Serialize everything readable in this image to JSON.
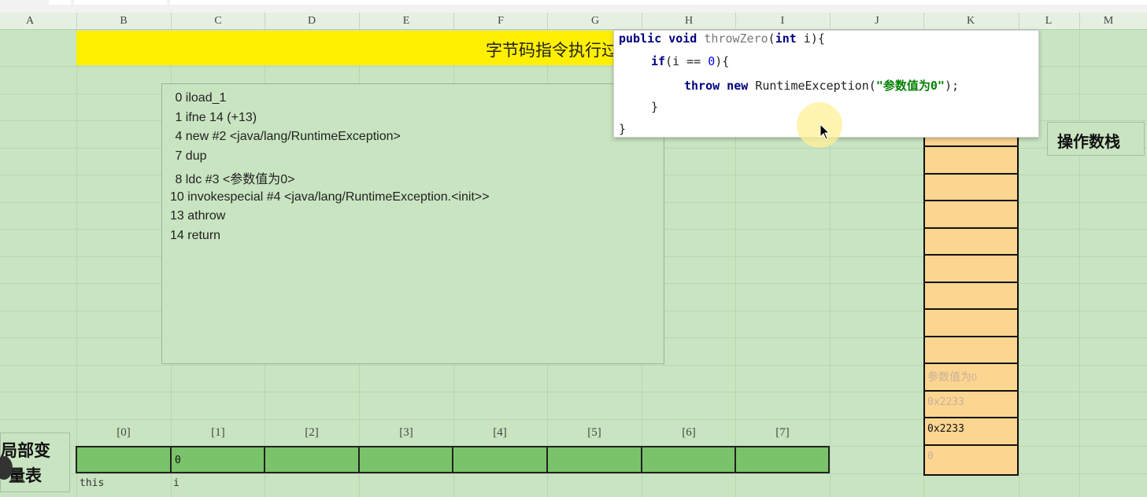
{
  "columns": [
    "A",
    "B",
    "C",
    "D",
    "E",
    "F",
    "G",
    "H",
    "I",
    "J",
    "K",
    "L",
    "M"
  ],
  "title": "字节码指令执行过程8",
  "bytecode": [
    " 0 iload_1",
    " 1 ifne 14 (+13)",
    " 4 new #2 <java/lang/RuntimeException>",
    " 7 dup",
    " 8 ldc #3 <参数值为0>",
    "10 invokespecial #4 <java/lang/RuntimeException.<init>>",
    "13 athrow",
    "14 return"
  ],
  "code": {
    "l1_kw": "public void ",
    "l1_method": "throwZero",
    "l1_open": "(",
    "l1_type": "int",
    "l1_rest": " i){",
    "l2_kw": "if",
    "l2_mid": "(i == ",
    "l2_num": "0",
    "l2_end": "){",
    "l3_kw": "throw new ",
    "l3_cls": "RuntimeException(",
    "l3_str": "\"参数值为0\"",
    "l3_end": ");",
    "l4": "}",
    "l5": "}"
  },
  "operand_stack": {
    "label": "操作数栈",
    "cells": [
      "",
      "",
      "",
      "",
      "",
      "",
      "",
      "",
      "参数值为0",
      "0x2233",
      "0x2233",
      "0"
    ]
  },
  "local_vars": {
    "label_line1": "局部变",
    "label_line2": "量表",
    "indices": [
      "[0]",
      "[1]",
      "[2]",
      "[3]",
      "[4]",
      "[5]",
      "[6]",
      "[7]"
    ],
    "values": [
      "",
      "0",
      "",
      "",
      "",
      "",
      "",
      ""
    ],
    "names": [
      "this",
      "i"
    ]
  }
}
